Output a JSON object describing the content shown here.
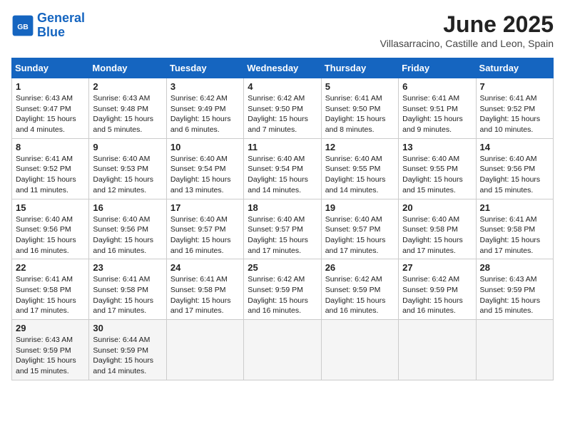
{
  "header": {
    "logo_line1": "General",
    "logo_line2": "Blue",
    "month": "June 2025",
    "location": "Villasarracino, Castille and Leon, Spain"
  },
  "days_of_week": [
    "Sunday",
    "Monday",
    "Tuesday",
    "Wednesday",
    "Thursday",
    "Friday",
    "Saturday"
  ],
  "weeks": [
    [
      {
        "day": "1",
        "sunrise": "6:43 AM",
        "sunset": "9:47 PM",
        "daylight": "15 hours and 4 minutes."
      },
      {
        "day": "2",
        "sunrise": "6:43 AM",
        "sunset": "9:48 PM",
        "daylight": "15 hours and 5 minutes."
      },
      {
        "day": "3",
        "sunrise": "6:42 AM",
        "sunset": "9:49 PM",
        "daylight": "15 hours and 6 minutes."
      },
      {
        "day": "4",
        "sunrise": "6:42 AM",
        "sunset": "9:50 PM",
        "daylight": "15 hours and 7 minutes."
      },
      {
        "day": "5",
        "sunrise": "6:41 AM",
        "sunset": "9:50 PM",
        "daylight": "15 hours and 8 minutes."
      },
      {
        "day": "6",
        "sunrise": "6:41 AM",
        "sunset": "9:51 PM",
        "daylight": "15 hours and 9 minutes."
      },
      {
        "day": "7",
        "sunrise": "6:41 AM",
        "sunset": "9:52 PM",
        "daylight": "15 hours and 10 minutes."
      }
    ],
    [
      {
        "day": "8",
        "sunrise": "6:41 AM",
        "sunset": "9:52 PM",
        "daylight": "15 hours and 11 minutes."
      },
      {
        "day": "9",
        "sunrise": "6:40 AM",
        "sunset": "9:53 PM",
        "daylight": "15 hours and 12 minutes."
      },
      {
        "day": "10",
        "sunrise": "6:40 AM",
        "sunset": "9:54 PM",
        "daylight": "15 hours and 13 minutes."
      },
      {
        "day": "11",
        "sunrise": "6:40 AM",
        "sunset": "9:54 PM",
        "daylight": "15 hours and 14 minutes."
      },
      {
        "day": "12",
        "sunrise": "6:40 AM",
        "sunset": "9:55 PM",
        "daylight": "15 hours and 14 minutes."
      },
      {
        "day": "13",
        "sunrise": "6:40 AM",
        "sunset": "9:55 PM",
        "daylight": "15 hours and 15 minutes."
      },
      {
        "day": "14",
        "sunrise": "6:40 AM",
        "sunset": "9:56 PM",
        "daylight": "15 hours and 15 minutes."
      }
    ],
    [
      {
        "day": "15",
        "sunrise": "6:40 AM",
        "sunset": "9:56 PM",
        "daylight": "15 hours and 16 minutes."
      },
      {
        "day": "16",
        "sunrise": "6:40 AM",
        "sunset": "9:56 PM",
        "daylight": "15 hours and 16 minutes."
      },
      {
        "day": "17",
        "sunrise": "6:40 AM",
        "sunset": "9:57 PM",
        "daylight": "15 hours and 16 minutes."
      },
      {
        "day": "18",
        "sunrise": "6:40 AM",
        "sunset": "9:57 PM",
        "daylight": "15 hours and 17 minutes."
      },
      {
        "day": "19",
        "sunrise": "6:40 AM",
        "sunset": "9:57 PM",
        "daylight": "15 hours and 17 minutes."
      },
      {
        "day": "20",
        "sunrise": "6:40 AM",
        "sunset": "9:58 PM",
        "daylight": "15 hours and 17 minutes."
      },
      {
        "day": "21",
        "sunrise": "6:41 AM",
        "sunset": "9:58 PM",
        "daylight": "15 hours and 17 minutes."
      }
    ],
    [
      {
        "day": "22",
        "sunrise": "6:41 AM",
        "sunset": "9:58 PM",
        "daylight": "15 hours and 17 minutes."
      },
      {
        "day": "23",
        "sunrise": "6:41 AM",
        "sunset": "9:58 PM",
        "daylight": "15 hours and 17 minutes."
      },
      {
        "day": "24",
        "sunrise": "6:41 AM",
        "sunset": "9:58 PM",
        "daylight": "15 hours and 17 minutes."
      },
      {
        "day": "25",
        "sunrise": "6:42 AM",
        "sunset": "9:59 PM",
        "daylight": "15 hours and 16 minutes."
      },
      {
        "day": "26",
        "sunrise": "6:42 AM",
        "sunset": "9:59 PM",
        "daylight": "15 hours and 16 minutes."
      },
      {
        "day": "27",
        "sunrise": "6:42 AM",
        "sunset": "9:59 PM",
        "daylight": "15 hours and 16 minutes."
      },
      {
        "day": "28",
        "sunrise": "6:43 AM",
        "sunset": "9:59 PM",
        "daylight": "15 hours and 15 minutes."
      }
    ],
    [
      {
        "day": "29",
        "sunrise": "6:43 AM",
        "sunset": "9:59 PM",
        "daylight": "15 hours and 15 minutes."
      },
      {
        "day": "30",
        "sunrise": "6:44 AM",
        "sunset": "9:59 PM",
        "daylight": "15 hours and 14 minutes."
      },
      null,
      null,
      null,
      null,
      null
    ]
  ]
}
